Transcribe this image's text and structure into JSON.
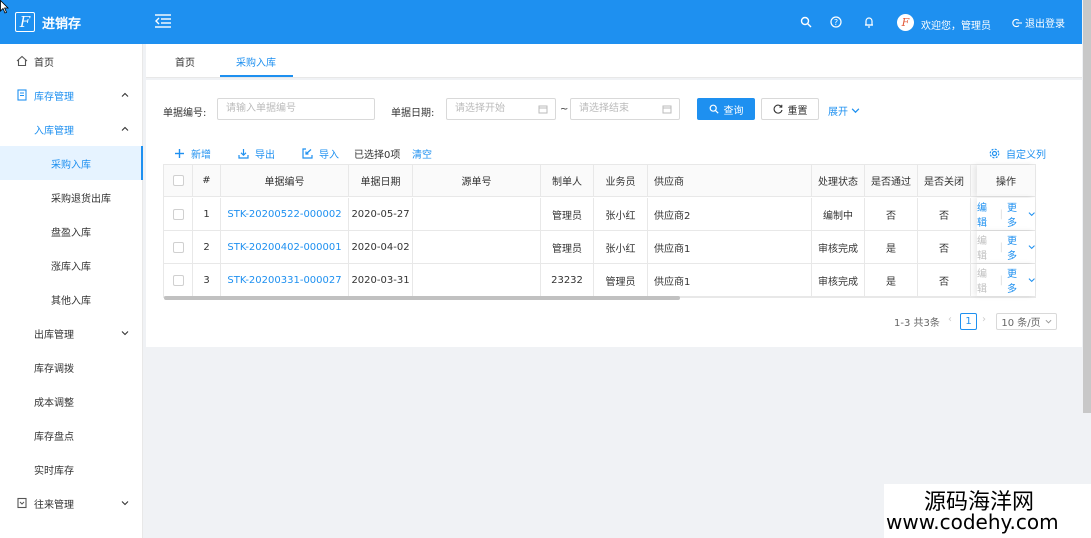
{
  "header": {
    "logo_letter": "F",
    "app_title": "进销存",
    "welcome": "欢迎您，管理员",
    "logout": "退出登录",
    "avatar_letter": "F"
  },
  "sidebar": {
    "items": [
      {
        "label": "首页",
        "icon": "home-icon"
      },
      {
        "label": "库存管理",
        "icon": "document-icon"
      },
      {
        "label": "入库管理"
      },
      {
        "label": "采购入库"
      },
      {
        "label": "采购退货出库"
      },
      {
        "label": "盘盈入库"
      },
      {
        "label": "涨库入库"
      },
      {
        "label": "其他入库"
      },
      {
        "label": "出库管理"
      },
      {
        "label": "库存调拨"
      },
      {
        "label": "成本调整"
      },
      {
        "label": "库存盘点"
      },
      {
        "label": "实时库存"
      },
      {
        "label": "往来管理",
        "icon": "exchange-icon"
      }
    ]
  },
  "tabs": [
    {
      "label": "首页"
    },
    {
      "label": "采购入库"
    }
  ],
  "search": {
    "doc_no_label": "单据编号:",
    "doc_no_placeholder": "请输入单据编号",
    "date_label": "单据日期:",
    "date_start_placeholder": "请选择开始",
    "date_sep": "~",
    "date_end_placeholder": "请选择结束",
    "query_button": "查询",
    "reset_button": "重置",
    "expand_link": "展开"
  },
  "toolbar": {
    "add": "新增",
    "export": "导出",
    "import": "导入",
    "selected": "已选择0项",
    "clear": "清空",
    "custom_columns": "自定义列"
  },
  "table": {
    "headers": [
      "#",
      "单据编号",
      "单据日期",
      "源单号",
      "制单人",
      "业务员",
      "供应商",
      "处理状态",
      "是否通过",
      "是否关闭",
      "操作"
    ],
    "rows": [
      {
        "idx": "1",
        "doc_no": "STK-20200522-000002",
        "date": "2020-05-27",
        "source": "",
        "maker": "管理员",
        "salesman": "张小红",
        "supplier": "供应商2",
        "status": "编制中",
        "passed": "否",
        "closed": "否",
        "edit": "编辑",
        "more": "更多"
      },
      {
        "idx": "2",
        "doc_no": "STK-20200402-000001",
        "date": "2020-04-02",
        "source": "",
        "maker": "管理员",
        "salesman": "张小红",
        "supplier": "供应商1",
        "status": "审核完成",
        "passed": "是",
        "closed": "否",
        "edit": "编辑",
        "more": "更多"
      },
      {
        "idx": "3",
        "doc_no": "STK-20200331-000027",
        "date": "2020-03-31",
        "source": "",
        "maker": "23232",
        "salesman": "管理员",
        "supplier": "供应商1",
        "status": "审核完成",
        "passed": "是",
        "closed": "否",
        "edit": "编辑",
        "more": "更多"
      }
    ]
  },
  "pagination": {
    "summary": "1-3 共3条",
    "current_page": "1",
    "page_size": "10 条/页"
  },
  "watermark": {
    "line1": "源码海洋网",
    "line2": "www.codehy.com"
  },
  "colors": {
    "primary": "#1e90f0",
    "active_bg": "#e6f3ff"
  }
}
